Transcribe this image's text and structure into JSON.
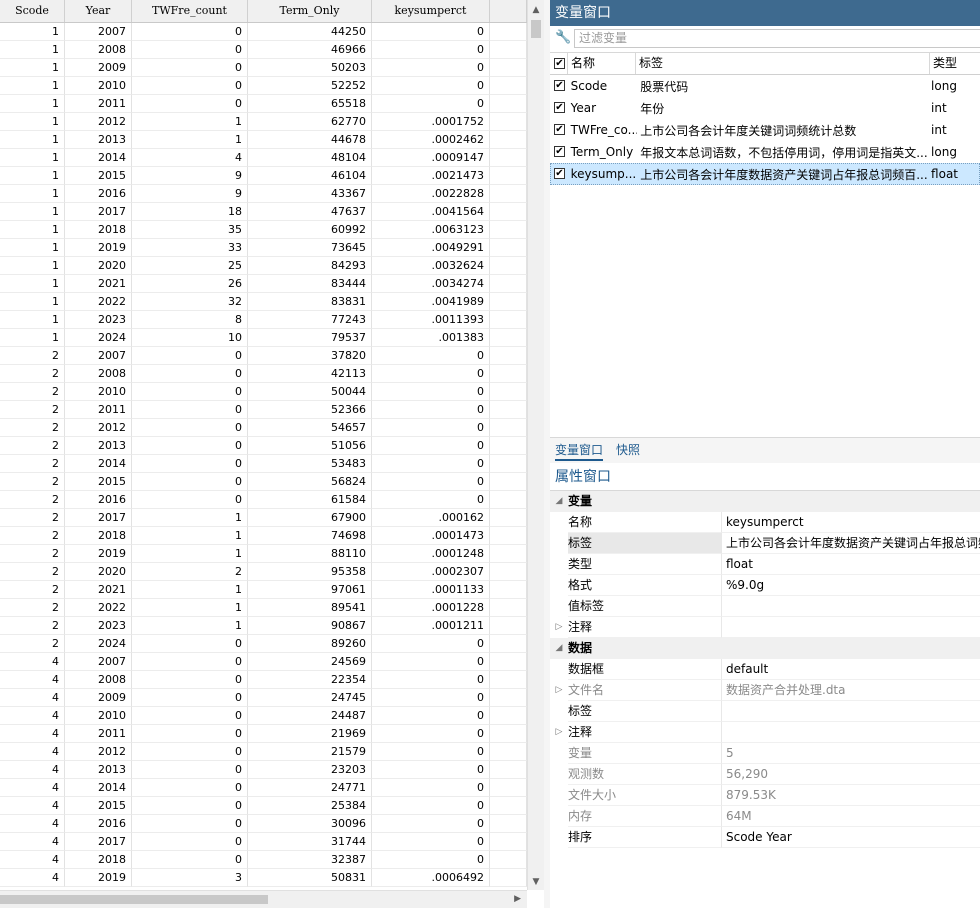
{
  "grid": {
    "columns": [
      "Scode",
      "Year",
      "TWFre_count",
      "Term_Only",
      "keysumperct"
    ],
    "rows": [
      [
        "1",
        "2007",
        "0",
        "44250",
        "0"
      ],
      [
        "1",
        "2008",
        "0",
        "46966",
        "0"
      ],
      [
        "1",
        "2009",
        "0",
        "50203",
        "0"
      ],
      [
        "1",
        "2010",
        "0",
        "52252",
        "0"
      ],
      [
        "1",
        "2011",
        "0",
        "65518",
        "0"
      ],
      [
        "1",
        "2012",
        "1",
        "62770",
        ".0001752"
      ],
      [
        "1",
        "2013",
        "1",
        "44678",
        ".0002462"
      ],
      [
        "1",
        "2014",
        "4",
        "48104",
        ".0009147"
      ],
      [
        "1",
        "2015",
        "9",
        "46104",
        ".0021473"
      ],
      [
        "1",
        "2016",
        "9",
        "43367",
        ".0022828"
      ],
      [
        "1",
        "2017",
        "18",
        "47637",
        ".0041564"
      ],
      [
        "1",
        "2018",
        "35",
        "60992",
        ".0063123"
      ],
      [
        "1",
        "2019",
        "33",
        "73645",
        ".0049291"
      ],
      [
        "1",
        "2020",
        "25",
        "84293",
        ".0032624"
      ],
      [
        "1",
        "2021",
        "26",
        "83444",
        ".0034274"
      ],
      [
        "1",
        "2022",
        "32",
        "83831",
        ".0041989"
      ],
      [
        "1",
        "2023",
        "8",
        "77243",
        ".0011393"
      ],
      [
        "1",
        "2024",
        "10",
        "79537",
        ".001383"
      ],
      [
        "2",
        "2007",
        "0",
        "37820",
        "0"
      ],
      [
        "2",
        "2008",
        "0",
        "42113",
        "0"
      ],
      [
        "2",
        "2010",
        "0",
        "50044",
        "0"
      ],
      [
        "2",
        "2011",
        "0",
        "52366",
        "0"
      ],
      [
        "2",
        "2012",
        "0",
        "54657",
        "0"
      ],
      [
        "2",
        "2013",
        "0",
        "51056",
        "0"
      ],
      [
        "2",
        "2014",
        "0",
        "53483",
        "0"
      ],
      [
        "2",
        "2015",
        "0",
        "56824",
        "0"
      ],
      [
        "2",
        "2016",
        "0",
        "61584",
        "0"
      ],
      [
        "2",
        "2017",
        "1",
        "67900",
        ".000162"
      ],
      [
        "2",
        "2018",
        "1",
        "74698",
        ".0001473"
      ],
      [
        "2",
        "2019",
        "1",
        "88110",
        ".0001248"
      ],
      [
        "2",
        "2020",
        "2",
        "95358",
        ".0002307"
      ],
      [
        "2",
        "2021",
        "1",
        "97061",
        ".0001133"
      ],
      [
        "2",
        "2022",
        "1",
        "89541",
        ".0001228"
      ],
      [
        "2",
        "2023",
        "1",
        "90867",
        ".0001211"
      ],
      [
        "2",
        "2024",
        "0",
        "89260",
        "0"
      ],
      [
        "4",
        "2007",
        "0",
        "24569",
        "0"
      ],
      [
        "4",
        "2008",
        "0",
        "22354",
        "0"
      ],
      [
        "4",
        "2009",
        "0",
        "24745",
        "0"
      ],
      [
        "4",
        "2010",
        "0",
        "24487",
        "0"
      ],
      [
        "4",
        "2011",
        "0",
        "21969",
        "0"
      ],
      [
        "4",
        "2012",
        "0",
        "21579",
        "0"
      ],
      [
        "4",
        "2013",
        "0",
        "23203",
        "0"
      ],
      [
        "4",
        "2014",
        "0",
        "24771",
        "0"
      ],
      [
        "4",
        "2015",
        "0",
        "25384",
        "0"
      ],
      [
        "4",
        "2016",
        "0",
        "30096",
        "0"
      ],
      [
        "4",
        "2017",
        "0",
        "31744",
        "0"
      ],
      [
        "4",
        "2018",
        "0",
        "32387",
        "0"
      ],
      [
        "4",
        "2019",
        "3",
        "50831",
        ".0006492"
      ]
    ]
  },
  "variables_window": {
    "title": "变量窗口",
    "filter_placeholder": "过滤变量",
    "headers": {
      "name": "名称",
      "label": "标签",
      "type": "类型"
    },
    "vars": [
      {
        "name": "Scode",
        "label": "股票代码",
        "type": "long"
      },
      {
        "name": "Year",
        "label": "年份",
        "type": "int"
      },
      {
        "name": "TWFre_co...",
        "label": "上市公司各会计年度关键词词频统计总数",
        "type": "int"
      },
      {
        "name": "Term_Only",
        "label": "年报文本总词语数，不包括停用词，停用词是指英文...",
        "type": "long"
      },
      {
        "name": "keysump...",
        "label": "上市公司各会计年度数据资产关键词占年报总词频百...",
        "type": "float"
      }
    ],
    "tabs": [
      "变量窗口",
      "快照"
    ]
  },
  "properties_window": {
    "title": "属性窗口",
    "sections": {
      "variable": "变量",
      "data": "数据"
    },
    "variable_props": [
      {
        "key": "名称",
        "value": "keysumperct"
      },
      {
        "key": "标签",
        "value": "上市公司各会计年度数据资产关键词占年报总词频"
      },
      {
        "key": "类型",
        "value": "float"
      },
      {
        "key": "格式",
        "value": "%9.0g"
      },
      {
        "key": "值标签",
        "value": ""
      },
      {
        "key": "注释",
        "value": ""
      }
    ],
    "data_props": [
      {
        "key": "数据框",
        "value": "default"
      },
      {
        "key": "文件名",
        "value": "数据资产合并处理.dta"
      },
      {
        "key": "标签",
        "value": ""
      },
      {
        "key": "注释",
        "value": ""
      },
      {
        "key": "变量",
        "value": "5"
      },
      {
        "key": "观测数",
        "value": "56,290"
      },
      {
        "key": "文件大小",
        "value": "879.53K"
      },
      {
        "key": "内存",
        "value": "64M"
      },
      {
        "key": "排序",
        "value": "Scode Year"
      }
    ]
  }
}
